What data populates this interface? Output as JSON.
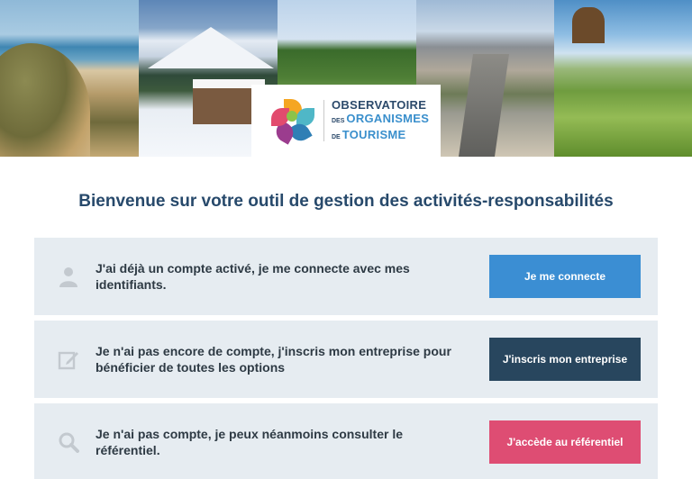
{
  "logo": {
    "line1": "OBSERVATOIRE",
    "line2_prefix": "DES",
    "line2": "ORGANISMES",
    "line3_prefix": "DE",
    "line3": "TOURISME"
  },
  "heading": "Bienvenue sur votre outil de gestion des activités-responsabilités",
  "options": [
    {
      "icon": "user-icon",
      "text": "J'ai déjà un compte activé, je me connecte avec mes identifiants.",
      "button": "Je me connecte",
      "button_color": "#3b8ed3"
    },
    {
      "icon": "edit-icon",
      "text": "Je n'ai pas encore de compte, j'inscris mon entreprise pour bénéficier de toutes les options",
      "button": "J'inscris mon entreprise",
      "button_color": "#28465e"
    },
    {
      "icon": "search-icon",
      "text": "Je n'ai pas compte, je peux néanmoins consulter le référentiel.",
      "button": "J'accède au référentiel",
      "button_color": "#de4d73"
    }
  ],
  "colors": {
    "heading": "#27496b",
    "row_background": "#e6ecf1",
    "icon": "#c3c9cf"
  }
}
